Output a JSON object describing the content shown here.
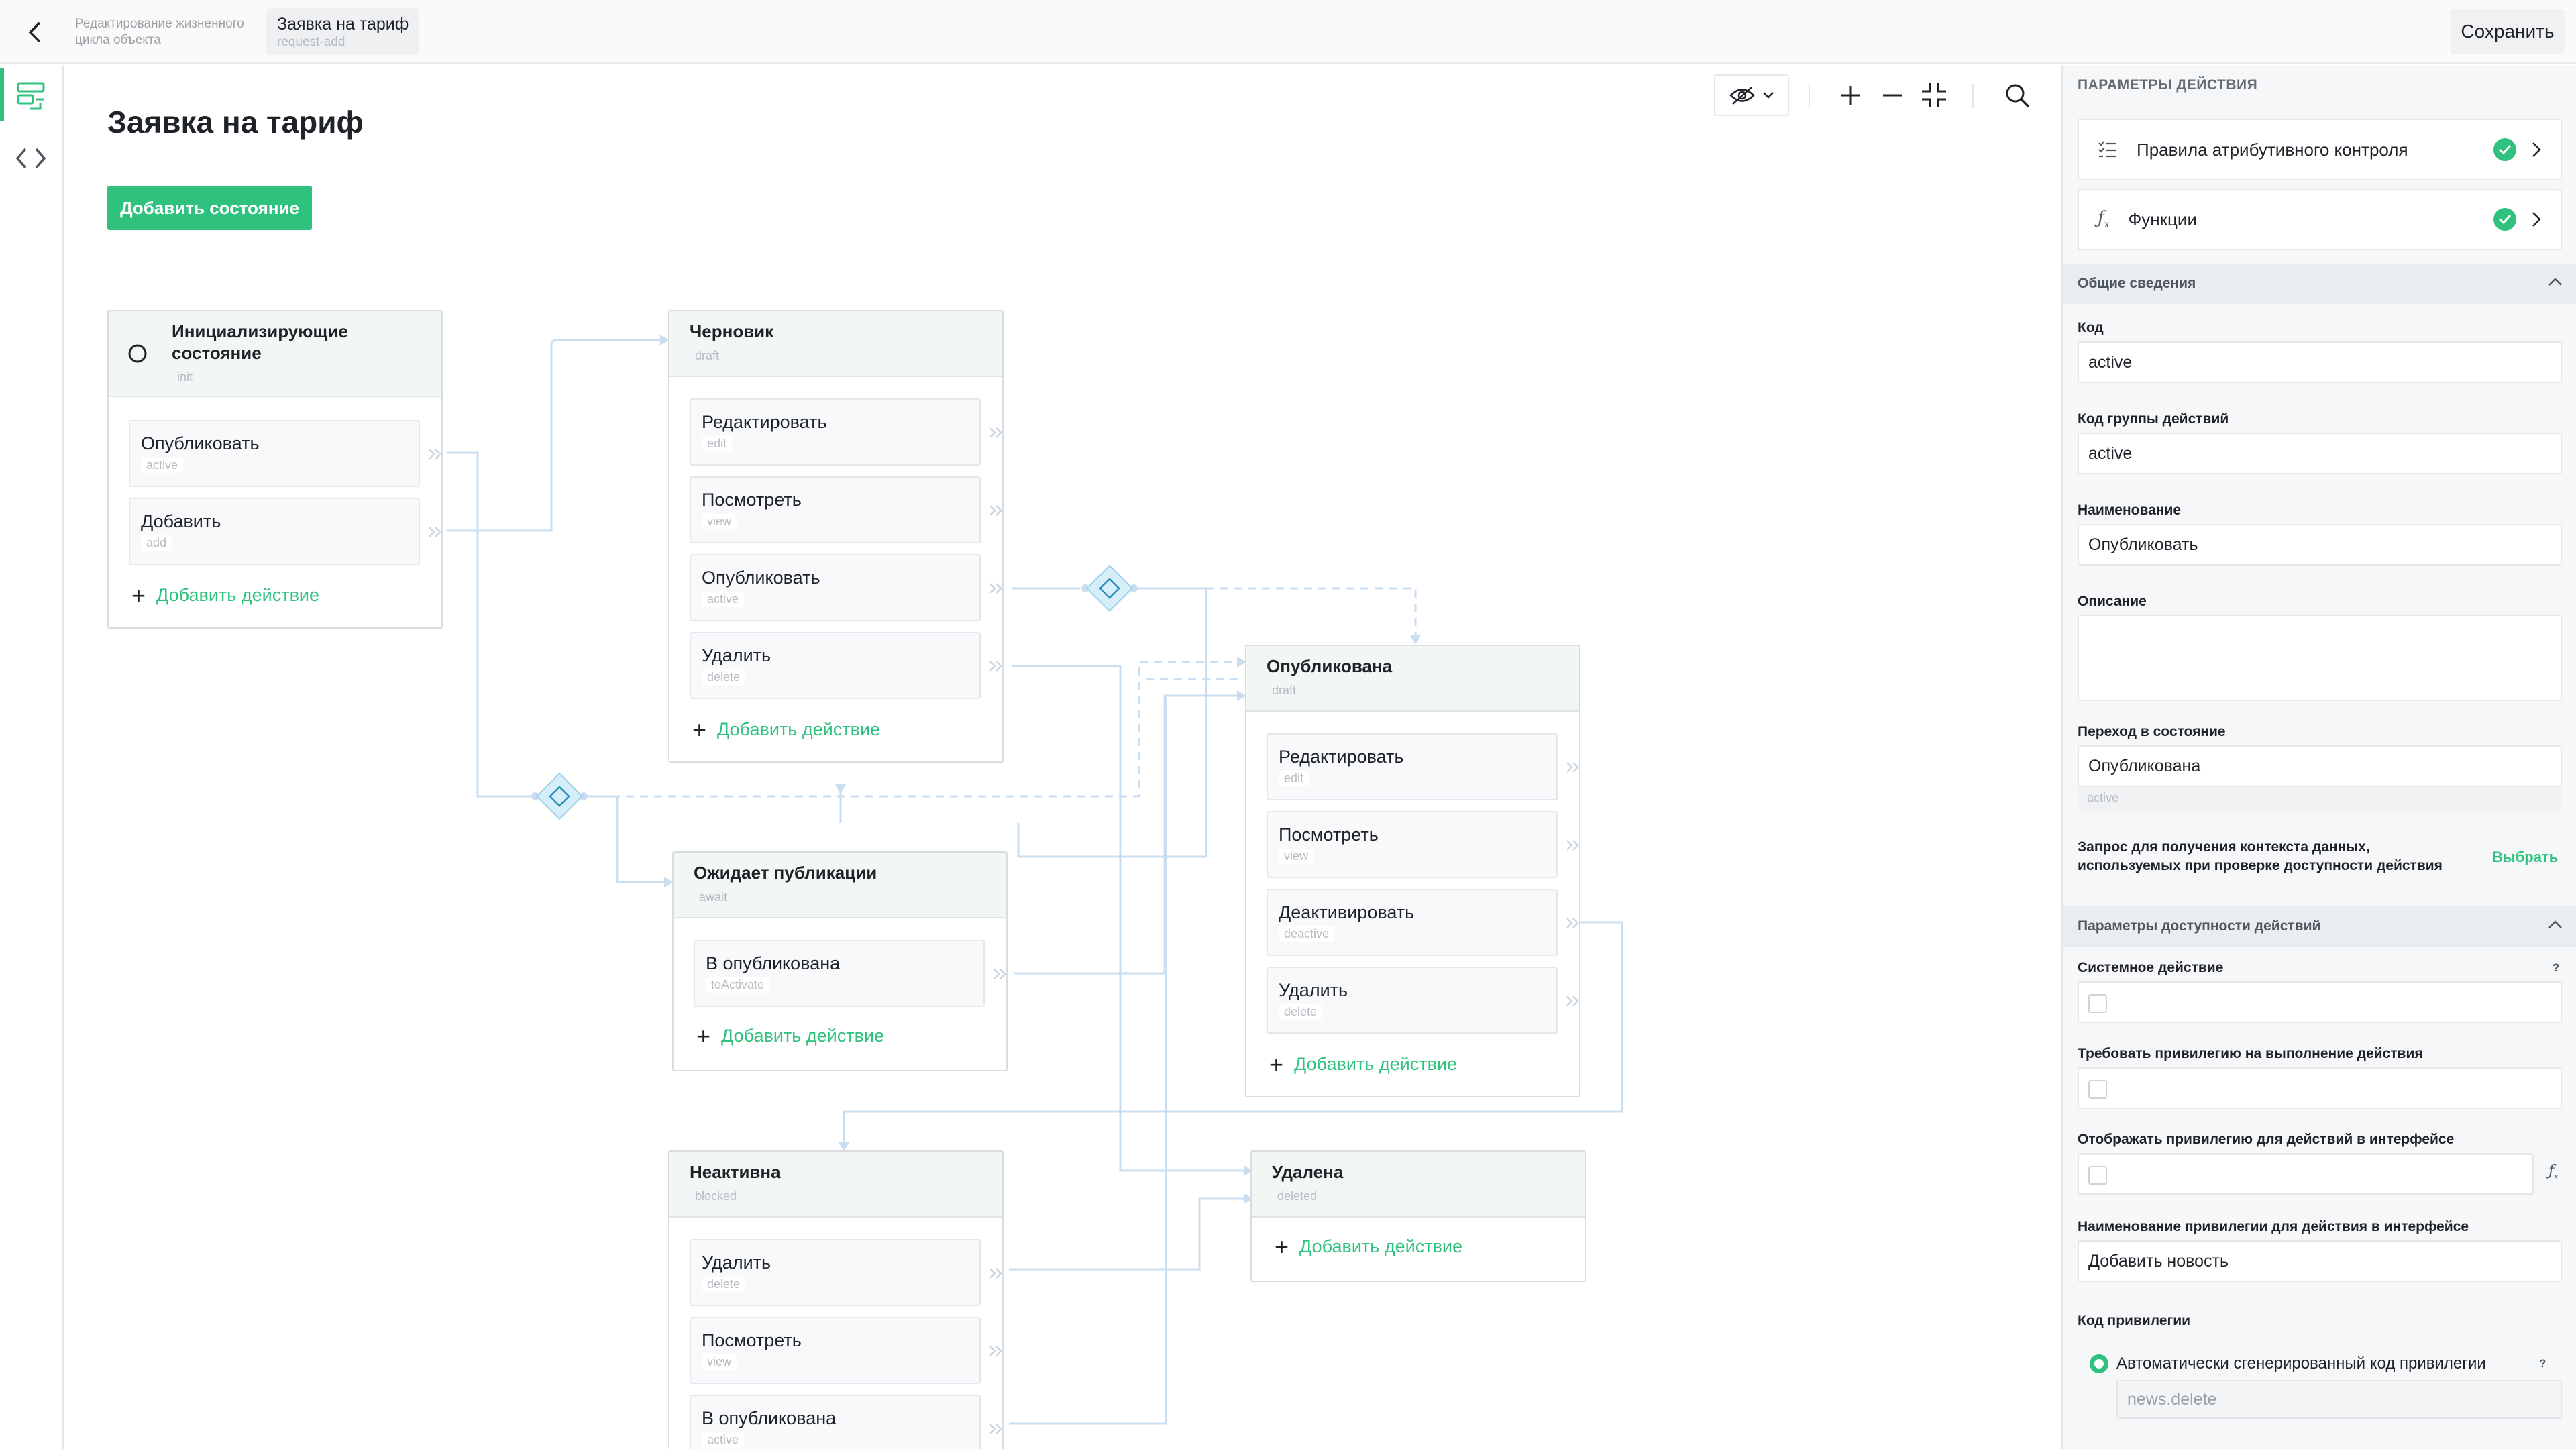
{
  "header": {
    "breadcrumb_prev": "Редактирование жизненного цикла объекта",
    "breadcrumb_current_title": "Заявка на тариф",
    "breadcrumb_current_code": "request-add",
    "save_label": "Сохранить"
  },
  "canvas": {
    "title": "Заявка на тариф",
    "add_state_label": "Добавить состояние",
    "add_action_label": "Добавить действие",
    "states": {
      "init": {
        "name": "Инициализирующие состояние",
        "code": "init",
        "actions": [
          {
            "name": "Опубликовать",
            "code": "active"
          },
          {
            "name": "Добавить",
            "code": "add"
          }
        ]
      },
      "draft": {
        "name": "Черновик",
        "code": "draft",
        "actions": [
          {
            "name": "Редактировать",
            "code": "edit"
          },
          {
            "name": "Посмотреть",
            "code": "view"
          },
          {
            "name": "Опубликовать",
            "code": "active"
          },
          {
            "name": "Удалить",
            "code": "delete"
          }
        ]
      },
      "await": {
        "name": "Ожидает публикации",
        "code": "await",
        "actions": [
          {
            "name": "В опубликована",
            "code": "toActivate"
          }
        ]
      },
      "published": {
        "name": "Опубликована",
        "code": "draft",
        "actions": [
          {
            "name": "Редактировать",
            "code": "edit"
          },
          {
            "name": "Посмотреть",
            "code": "view"
          },
          {
            "name": "Деактивировать",
            "code": "deactive"
          },
          {
            "name": "Удалить",
            "code": "delete"
          }
        ]
      },
      "blocked": {
        "name": "Неактивна",
        "code": "blocked",
        "actions": [
          {
            "name": "Удалить",
            "code": "delete"
          },
          {
            "name": "Посмотреть",
            "code": "view"
          },
          {
            "name": "В опубликована",
            "code": "active"
          }
        ]
      },
      "deleted": {
        "name": "Удалена",
        "code": "deleted",
        "actions": []
      }
    }
  },
  "panel": {
    "title": "ПАРАМЕТРЫ ДЕЙСТВИЯ",
    "card_rules": "Правила атрибутивного контроля",
    "card_functions": "Функции",
    "section_general": "Общие сведения",
    "label_code": "Код",
    "value_code": "active",
    "label_group_code": "Код группы действий",
    "value_group_code": "active",
    "label_name": "Наименование",
    "value_name": "Опубликовать",
    "label_description": "Описание",
    "value_description": "",
    "label_transition": "Переход в состояние",
    "value_transition": "Опубликована",
    "value_transition_code": "active",
    "label_query": "Запрос для получения контекста данных, используемых при проверке доступности действия",
    "query_link": "Выбрать",
    "section_availability": "Параметры доступности действий",
    "label_system_action": "Системное действие",
    "label_require_privilege": "Требовать привилегию на выполнение действия",
    "label_show_privilege": "Отображать привилегию для действий в интерфейсе",
    "label_privilege_name": "Наименование привилегии для действия в интерфейсе",
    "value_privilege_name": "Добавить новость",
    "label_privilege_code": "Код привилегии",
    "radio_auto_code": "Автоматически сгенерированный код привилегии",
    "value_auto_code": "news.delete",
    "help_mark": "?",
    "fx_mark": "fx"
  },
  "colors": {
    "accent": "#2ec27e",
    "state_header": "#f1f8f4",
    "link_line": "#c9def0",
    "gateway": "#d6eef8"
  }
}
